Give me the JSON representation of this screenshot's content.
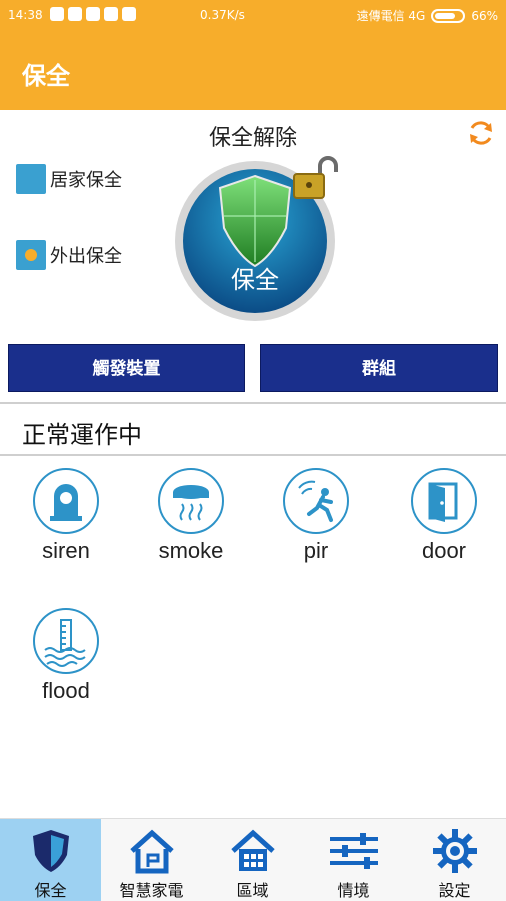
{
  "status_bar": {
    "time": "14:38",
    "speed": "0.37K/s",
    "carrier": "遠傳電信 4G",
    "battery": "66%"
  },
  "app_bar": {
    "title": "保全"
  },
  "security": {
    "state_title": "保全解除",
    "modes": [
      {
        "label": "居家保全",
        "selected": false
      },
      {
        "label": "外出保全",
        "selected": true
      }
    ],
    "big_button_label": "保全"
  },
  "actions": {
    "trigger_label": "觸發裝置",
    "group_label": "群組"
  },
  "status_text": "正常運作中",
  "devices": [
    {
      "name": "siren",
      "icon": "siren-icon"
    },
    {
      "name": "smoke",
      "icon": "smoke-detector-icon"
    },
    {
      "name": "pir",
      "icon": "pir-motion-icon"
    },
    {
      "name": "door",
      "icon": "door-icon"
    },
    {
      "name": "flood",
      "icon": "flood-icon"
    }
  ],
  "tabs": [
    {
      "label": "保全",
      "icon": "shield-icon",
      "active": true
    },
    {
      "label": "智慧家電",
      "icon": "smart-home-icon",
      "active": false
    },
    {
      "label": "區域",
      "icon": "area-house-icon",
      "active": false
    },
    {
      "label": "情境",
      "icon": "sliders-icon",
      "active": false
    },
    {
      "label": "設定",
      "icon": "gear-icon",
      "active": false
    }
  ],
  "colors": {
    "accent": "#f7ad2b",
    "primary_button": "#1a2f8c",
    "icon_stroke": "#2d93c8"
  }
}
